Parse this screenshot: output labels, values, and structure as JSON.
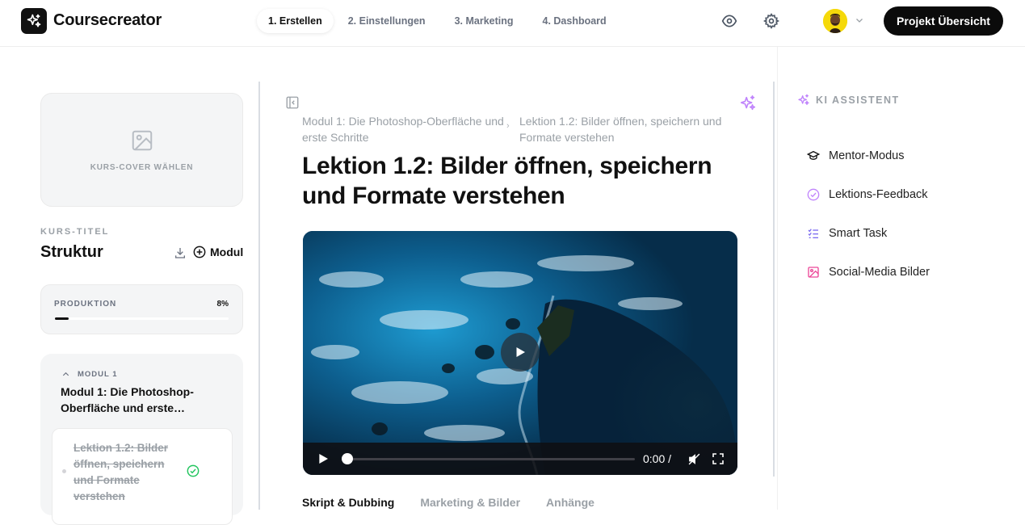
{
  "app": {
    "name": "Coursecreator",
    "logo_icon": "sparkles-icon"
  },
  "steps": [
    {
      "label": "1. Erstellen",
      "active": true
    },
    {
      "label": "2. Einstellungen",
      "active": false
    },
    {
      "label": "3. Marketing",
      "active": false
    },
    {
      "label": "4. Dashboard",
      "active": false
    }
  ],
  "header": {
    "project_button": "Projekt Übersicht",
    "preview_icon": "eye-icon",
    "settings_icon": "gear-icon"
  },
  "sidebar": {
    "cover_label": "KURS-COVER WÄHLEN",
    "course_title_label": "KURS-TITEL",
    "structure_title": "Struktur",
    "add_module_label": "Modul",
    "production": {
      "label": "PRODUKTION",
      "percent_text": "8%",
      "progress": 0.08
    },
    "module": {
      "number_label": "MODUL 1",
      "title": "Modul 1: Die Photoshop-Oberfläche und erste…",
      "lesson": {
        "title": "Lektion 1.2: Bilder öffnen, speichern und Formate verstehen",
        "completed": true
      }
    }
  },
  "main": {
    "breadcrumb": [
      "Modul 1: Die Photoshop-Oberfläche und erste Schritte",
      "Lektion 1.2: Bilder öffnen, speichern und Formate verstehen"
    ],
    "breadcrumb_separator": "›",
    "title": "Lektion 1.2: Bilder öffnen, speichern und Formate verstehen",
    "video": {
      "time": "0:00 /",
      "progress": 0.0
    },
    "tabs": [
      {
        "label": "Skript & Dubbing",
        "active": true
      },
      {
        "label": "Marketing & Bilder",
        "active": false
      },
      {
        "label": "Anhänge",
        "active": false
      }
    ]
  },
  "ai_panel": {
    "title": "KI ASSISTENT",
    "items": [
      {
        "label": "Mentor-Modus",
        "icon": "graduation-cap-icon"
      },
      {
        "label": "Lektions-Feedback",
        "icon": "check-circle-icon"
      },
      {
        "label": "Smart Task",
        "icon": "checklist-icon"
      },
      {
        "label": "Social-Media Bilder",
        "icon": "image-icon"
      }
    ]
  },
  "colors": {
    "accent_purple": "#c084fc",
    "check_green": "#22c55e",
    "pink": "#ec4899",
    "dark": "#0b0b0b"
  }
}
